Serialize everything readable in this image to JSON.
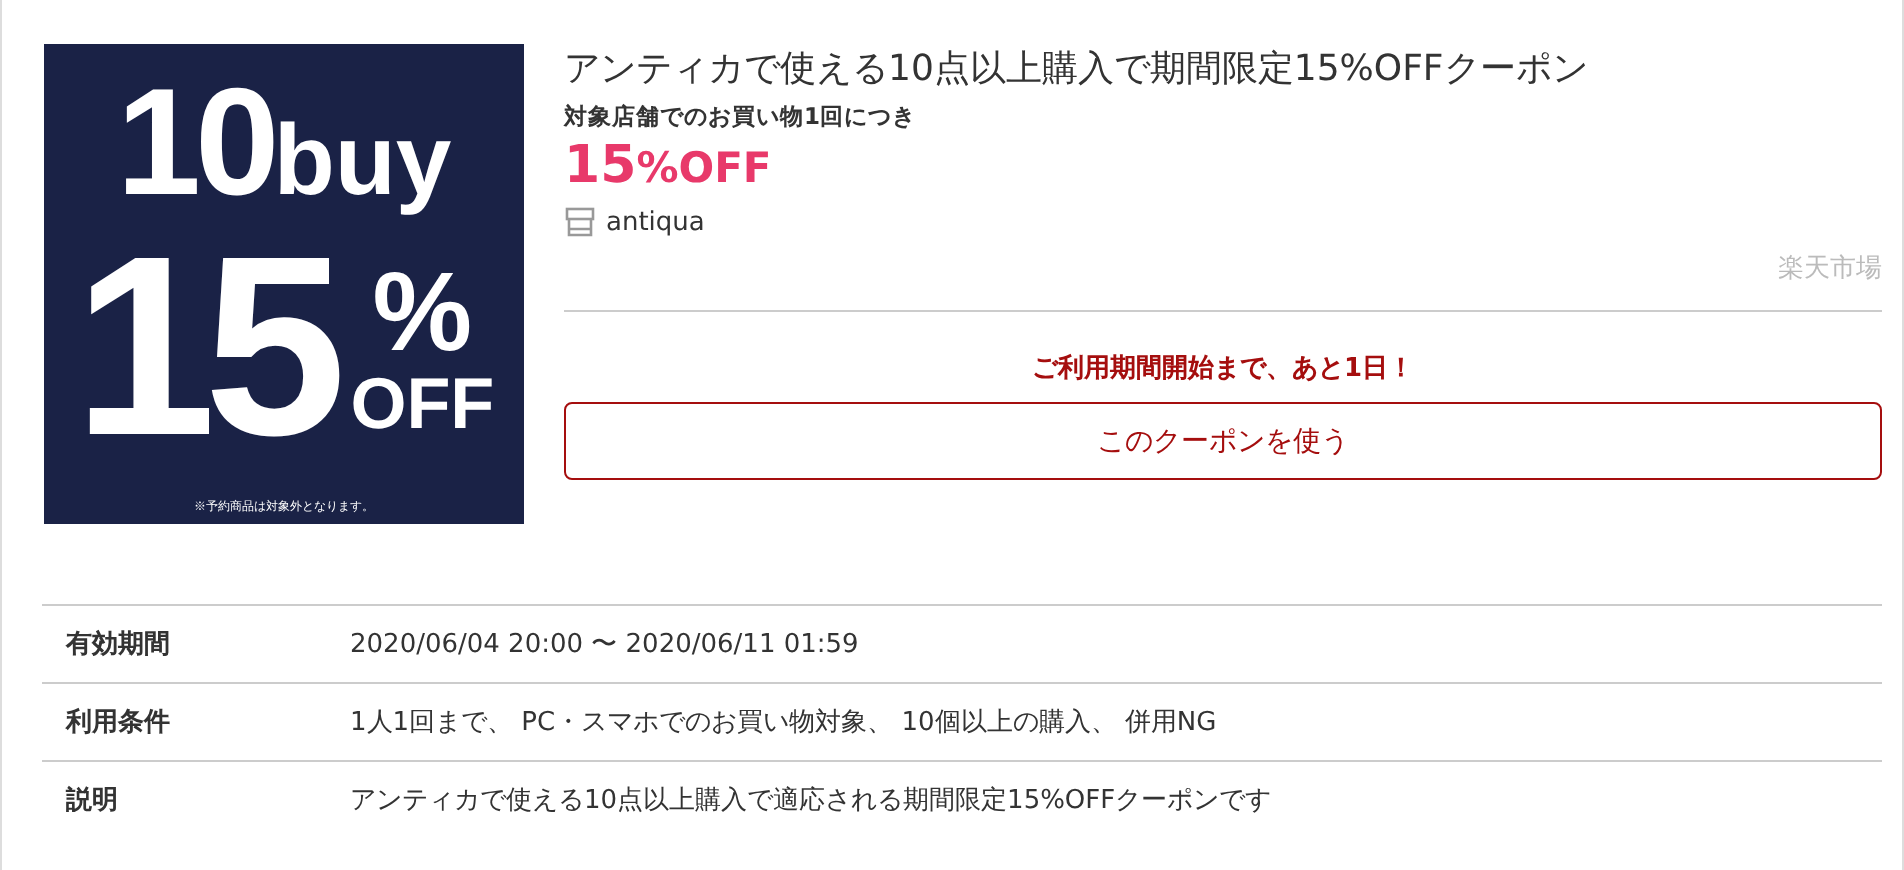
{
  "banner": {
    "count": "10",
    "unit": "buy",
    "percent": "15",
    "percent_sign": "%",
    "off": "OFF",
    "note": "※予約商品は対象外となります。"
  },
  "coupon": {
    "title": "アンティカで使える10点以上購入で期間限定15%OFFクーポン",
    "condition": "対象店舗でのお買い物1回につき",
    "discount_number": "15",
    "discount_suffix": "%OFF",
    "shop": "antiqua",
    "market": "楽天市場",
    "notice": "ご利用期間開始まで、あと1日！",
    "use_button": "このクーポンを使う"
  },
  "details": [
    {
      "label": "有効期間",
      "value": "2020/06/04 20:00 〜 2020/06/11 01:59"
    },
    {
      "label": "利用条件",
      "value": "1人1回まで、 PC・スマホでのお買い物対象、 10個以上の購入、 併用NG"
    },
    {
      "label": "説明",
      "value": "アンティカで使える10点以上購入で適応される期間限定15%OFFクーポンです"
    }
  ]
}
